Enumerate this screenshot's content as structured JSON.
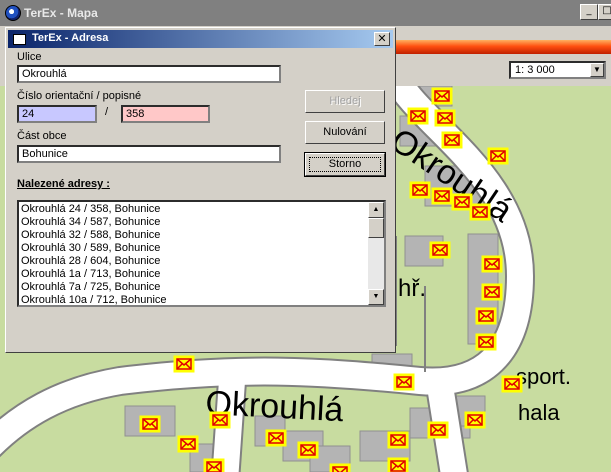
{
  "main_window": {
    "title": "TerEx - Mapa",
    "scale_value": "1:  3 000"
  },
  "map": {
    "street_labels": [
      "Okrouhlá",
      "Okrouhlá"
    ],
    "poi_labels": {
      "playground": "hř.",
      "sport_line1": "sport.",
      "sport_line2": "hala"
    }
  },
  "dialog": {
    "title": "TerEx  - Adresa",
    "street_label": "Ulice",
    "street_value": "Okrouhlá",
    "number_label": "Číslo orientační / popisné",
    "orient_value": "24",
    "separator": "/",
    "popisne_value": "358",
    "district_label": "Část obce",
    "district_value": "Bohunice",
    "found_label": "Nalezené adresy :",
    "buttons": {
      "search": "Hledej",
      "reset": "Nulování",
      "cancel": "Storno"
    },
    "results": [
      "Okrouhlá 24 / 358, Bohunice",
      "Okrouhlá 34 / 587, Bohunice",
      "Okrouhlá 32 / 588, Bohunice",
      "Okrouhlá 30 / 589, Bohunice",
      "Okrouhlá 28 / 604, Bohunice",
      "Okrouhlá 1a / 713, Bohunice",
      "Okrouhlá 7a / 725, Bohunice",
      "Okrouhlá 10a / 712, Bohunice"
    ]
  },
  "colors": {
    "map_bg": "#c8dca0",
    "road": "#ffffff",
    "building": "#b4b4b4",
    "marker_fill": "#ffff00",
    "marker_stroke": "#e00000",
    "orient_field": "#c8c8ff",
    "popisne_field": "#ffc8c8"
  }
}
